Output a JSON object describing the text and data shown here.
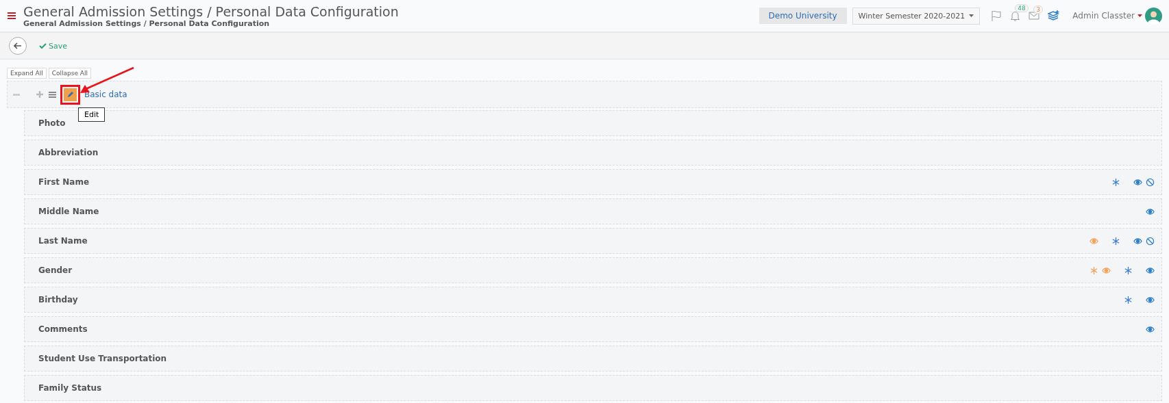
{
  "header": {
    "title": "General Admission Settings / Personal Data Configuration",
    "breadcrumb": "General Admission Settings / Personal Data Configuration",
    "institution": "Demo University",
    "semester": "Winter Semester 2020-2021",
    "notifications": "48",
    "messages": "3",
    "user": "Admin Classter"
  },
  "toolbar": {
    "save": "Save"
  },
  "tree_buttons": [
    "Expand All",
    "Collapse All"
  ],
  "group": {
    "title": "Basic data",
    "expanded": true,
    "tooltip": "Edit",
    "fields": [
      {
        "label": "Photo"
      },
      {
        "label": "Abbreviation"
      },
      {
        "label": "First Name",
        "icons": [
          {
            "kind": "asterisk",
            "color": "#3b7dd8"
          },
          {
            "kind": "eye",
            "color": "#2f7fc8"
          },
          {
            "kind": "ban",
            "color": "#2f7fc8"
          }
        ]
      },
      {
        "label": "Middle Name",
        "icons": [
          {
            "kind": "eye",
            "color": "#2f7fc8"
          }
        ]
      },
      {
        "label": "Last Name",
        "icons": [
          {
            "kind": "eye",
            "color": "#f4a25a"
          },
          {
            "kind": "asterisk",
            "color": "#3b7dd8"
          },
          {
            "kind": "eye",
            "color": "#2f7fc8"
          },
          {
            "kind": "ban",
            "color": "#2f7fc8"
          }
        ]
      },
      {
        "label": "Gender",
        "icons": [
          {
            "kind": "asterisk",
            "color": "#f4a25a"
          },
          {
            "kind": "eye",
            "color": "#f4a25a"
          },
          {
            "kind": "asterisk",
            "color": "#3b7dd8"
          },
          {
            "kind": "eye",
            "color": "#2f7fc8"
          }
        ]
      },
      {
        "label": "Birthday",
        "icons": [
          {
            "kind": "asterisk",
            "color": "#3b7dd8"
          },
          {
            "kind": "eye",
            "color": "#2f7fc8"
          }
        ]
      },
      {
        "label": "Comments",
        "icons": [
          {
            "kind": "eye",
            "color": "#2f7fc8"
          }
        ]
      },
      {
        "label": "Student Use Transportation"
      },
      {
        "label": "Family Status"
      }
    ]
  }
}
